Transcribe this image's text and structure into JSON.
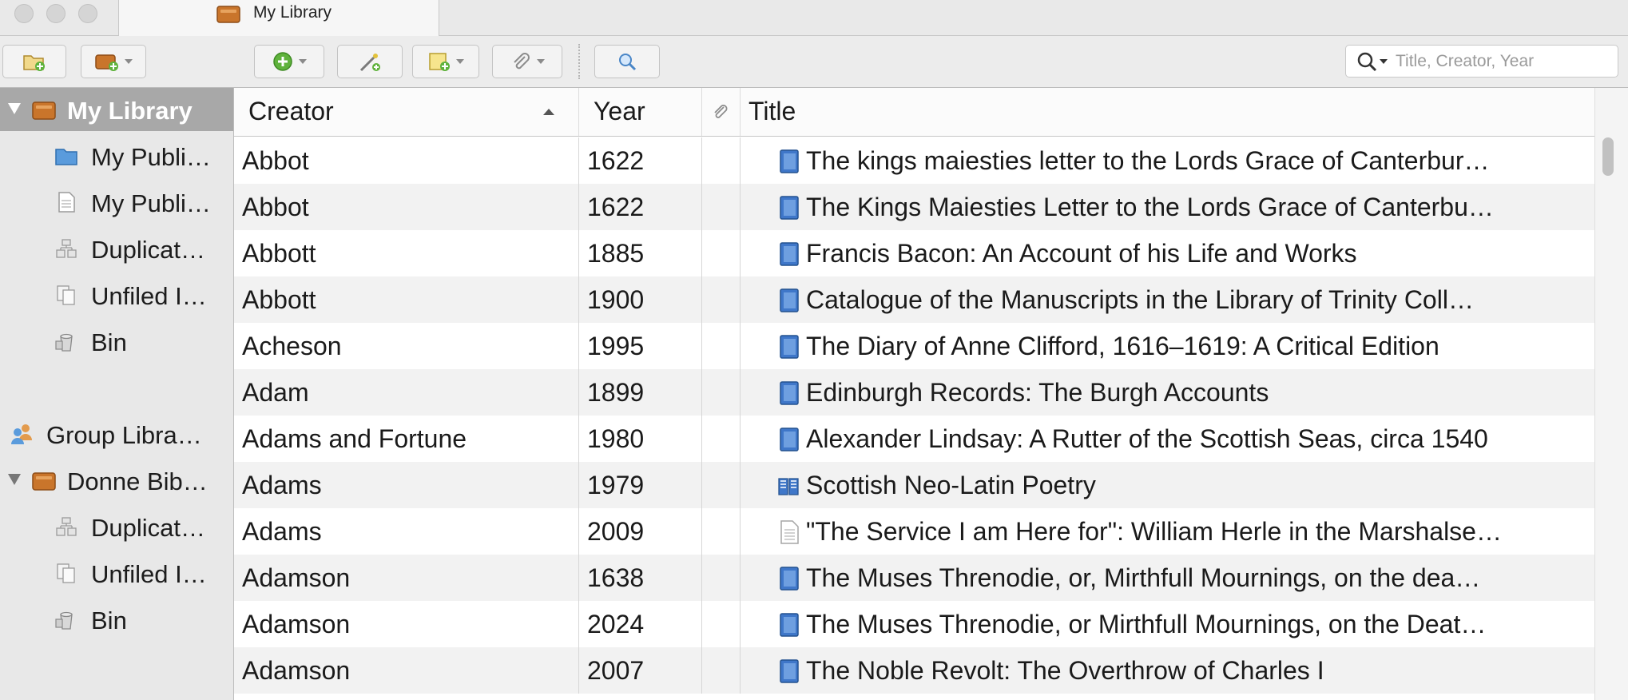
{
  "window": {
    "tab_title": "My Library"
  },
  "toolbar": {
    "buttons": [
      {
        "name": "new-collection-button",
        "icon": "folder-add-icon"
      },
      {
        "name": "new-library-button",
        "icon": "library-add-icon"
      },
      {
        "name": "new-item-button",
        "icon": "plus-circle-icon"
      },
      {
        "name": "add-by-identifier-button",
        "icon": "magic-wand-icon"
      },
      {
        "name": "new-note-button",
        "icon": "note-add-icon"
      },
      {
        "name": "add-attachment-button",
        "icon": "paperclip-icon"
      },
      {
        "name": "advanced-search-button",
        "icon": "magnifier-icon"
      }
    ],
    "search": {
      "placeholder": "Title, Creator, Year",
      "value": ""
    }
  },
  "sidebar": {
    "items": [
      {
        "label": "My Library",
        "icon": "library-icon",
        "selected": true
      },
      {
        "label": "My Publi…",
        "icon": "folder-icon"
      },
      {
        "label": "My Publi…",
        "icon": "document-icon"
      },
      {
        "label": "Duplicat…",
        "icon": "duplicate-icon"
      },
      {
        "label": "Unfiled I…",
        "icon": "unfiled-icon"
      },
      {
        "label": "Bin",
        "icon": "bin-icon"
      },
      {
        "label": "Group Libra…",
        "icon": "group-icon"
      },
      {
        "label": "Donne Bib…",
        "icon": "library-icon"
      },
      {
        "label": "Duplicat…",
        "icon": "duplicate-icon"
      },
      {
        "label": "Unfiled I…",
        "icon": "unfiled-icon"
      },
      {
        "label": "Bin",
        "icon": "bin-icon"
      }
    ]
  },
  "table": {
    "columns": {
      "creator": "Creator",
      "year": "Year",
      "title": "Title"
    },
    "sort": {
      "column": "creator",
      "direction": "ascending"
    },
    "rows": [
      {
        "creator": "Abbot",
        "year": "1622",
        "type": "book",
        "title": "The kings maiesties letter to the Lords Grace of Canterbur…"
      },
      {
        "creator": "Abbot",
        "year": "1622",
        "type": "book",
        "title": "The Kings Maiesties Letter to the Lords Grace of Canterbu…"
      },
      {
        "creator": "Abbott",
        "year": "1885",
        "type": "book",
        "title": "Francis Bacon: An Account of his Life and Works"
      },
      {
        "creator": "Abbott",
        "year": "1900",
        "type": "book",
        "title": "Catalogue of the Manuscripts in the Library of Trinity Coll…"
      },
      {
        "creator": "Acheson",
        "year": "1995",
        "type": "book",
        "title": "The Diary of Anne Clifford, 1616–1619: A Critical Edition"
      },
      {
        "creator": "Adam",
        "year": "1899",
        "type": "book",
        "title": "Edinburgh Records: The Burgh Accounts"
      },
      {
        "creator": "Adams and Fortune",
        "year": "1980",
        "type": "book",
        "title": "Alexander Lindsay: A Rutter of the Scottish Seas, circa 1540"
      },
      {
        "creator": "Adams",
        "year": "1979",
        "type": "book-section",
        "title": "Scottish Neo-Latin Poetry"
      },
      {
        "creator": "Adams",
        "year": "2009",
        "type": "document",
        "title": "\"The Service I am Here for\": William Herle in the Marshalse…"
      },
      {
        "creator": "Adamson",
        "year": "1638",
        "type": "book",
        "title": "The Muses Threnodie, or, Mirthfull Mournings, on the dea…"
      },
      {
        "creator": "Adamson",
        "year": "2024",
        "type": "book",
        "title": "The Muses Threnodie, or Mirthfull Mournings, on the Deat…"
      },
      {
        "creator": "Adamson",
        "year": "2007",
        "type": "book",
        "title": "The Noble Revolt: The Overthrow of Charles I"
      }
    ]
  },
  "colors": {
    "selected_sidebar": "#a8a8a8",
    "book_icon": "#3f77c9",
    "library_icon": "#c9752b"
  }
}
